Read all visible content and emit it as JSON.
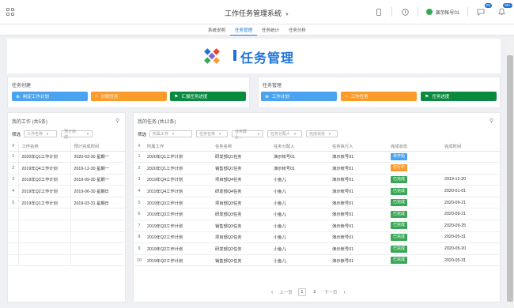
{
  "header": {
    "app_title": "工作任务管理系统",
    "user_name": "演示帐号01",
    "badge_messages": "66",
    "badge_notices": "99+"
  },
  "subnav": {
    "tabs": [
      {
        "label": "系统说明",
        "active": false
      },
      {
        "label": "任务管理",
        "active": true
      },
      {
        "label": "任务统计",
        "active": false
      },
      {
        "label": "任务分析",
        "active": false
      }
    ]
  },
  "banner": {
    "title": "任务管理"
  },
  "create_panel": {
    "title": "任务创建",
    "buttons": [
      {
        "label": "制定工作计划",
        "icon": "plus-circle-icon",
        "color": "#4aa3ee"
      },
      {
        "label": "分配任务",
        "icon": "home-icon",
        "color": "#fb9b2a"
      },
      {
        "label": "汇报任务进度",
        "icon": "flag-icon",
        "color": "#0a8a3e"
      }
    ]
  },
  "manage_panel": {
    "title": "任务管理",
    "buttons": [
      {
        "label": "工作计划",
        "icon": "plus-circle-icon",
        "color": "#4aa3ee"
      },
      {
        "label": "工作任务",
        "icon": "home-icon",
        "color": "#fb9b2a"
      },
      {
        "label": "任务进度",
        "icon": "flag-icon",
        "color": "#0a8a3e"
      }
    ]
  },
  "my_work": {
    "title": "我的工作 (共5条)",
    "filter_label": "筛选",
    "filters": [
      "工作名称",
      "预计完成..."
    ],
    "columns": [
      "#",
      "工作名称",
      "预计完成时间"
    ],
    "rows": [
      [
        "1",
        "2020年Q1工作计划",
        "2020-03-30 星期一"
      ],
      [
        "2",
        "2019年Q4工作计划",
        "2019-12-30 星期一"
      ],
      [
        "3",
        "2019年Q3工作计划",
        "2019-09-30 星期一"
      ],
      [
        "4",
        "2019年Q2工作计划",
        "2019-06-30 星期日"
      ],
      [
        "5",
        "2019年Q1工作计划",
        "2019-03-31 星期日"
      ]
    ]
  },
  "my_tasks": {
    "title": "我的任务 (共12条)",
    "filter_label": "筛选",
    "filters": [
      "所属工作",
      "任务名称",
      "任务截止...",
      "任务分配人",
      "完成状态"
    ],
    "columns": [
      "#",
      "所属工作",
      "任务名称",
      "任务分配人",
      "任务执行人",
      "完成状态",
      "完成时间"
    ],
    "rows": [
      [
        "1",
        "2020年Q1工作计划",
        "研发部Q1任务",
        "演示帐号01",
        "演示帐号01",
        "未开始",
        ""
      ],
      [
        "2",
        "2020年Q1工作计划",
        "销售部Q1任务",
        "演示帐号01",
        "演示帐号01",
        "进行中",
        ""
      ],
      [
        "3",
        "2019年Q4工作计划",
        "项目部Q4任务",
        "小鱼儿",
        "演示帐号01",
        "已完成",
        "2019-12-20"
      ],
      [
        "4",
        "2019年Q4工作计划",
        "研发部Q4任务",
        "小鱼儿",
        "演示帐号01",
        "已完成",
        "2020-01-01"
      ],
      [
        "5",
        "2019年Q3工作计划",
        "项目部Q3任务",
        "小鱼儿",
        "演示帐号01",
        "已完成",
        "2020-09-21"
      ],
      [
        "6",
        "2019年Q3工作计划",
        "研发部Q3任务",
        "小鱼儿",
        "演示帐号01",
        "已完成",
        "2020-09-21"
      ],
      [
        "7",
        "2019年Q3工作计划",
        "销售部Q3任务",
        "小鱼儿",
        "演示帐号01",
        "已完成",
        "2020-09-25"
      ],
      [
        "8",
        "2019年Q2工作计划",
        "项目部Q2任务",
        "小鱼儿",
        "演示帐号01",
        "已完成",
        "2020-05-31"
      ],
      [
        "9",
        "2019年Q2工作计划",
        "研发部Q2任务",
        "小鱼儿",
        "演示帐号01",
        "已完成",
        "2020-05-20"
      ],
      [
        "10",
        "2019年Q2工作计划",
        "销售部Q2任务",
        "小鱼儿",
        "演示帐号01",
        "已完成",
        "2020-05-31"
      ]
    ],
    "status_colors": {
      "未开始": "#4aa3ee",
      "进行中": "#fb9b2a",
      "已完成": "#3aa757"
    }
  },
  "pager": {
    "prev_label": "上一页",
    "next_label": "下一页",
    "pages": [
      "1",
      "2"
    ],
    "current": "1"
  }
}
